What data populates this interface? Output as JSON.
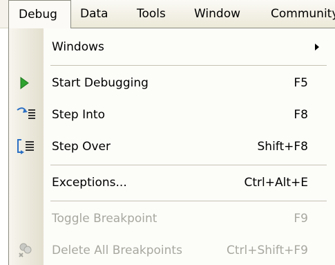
{
  "menubar": {
    "items": [
      {
        "label": "Debug"
      },
      {
        "label": "Data"
      },
      {
        "label": "Tools"
      },
      {
        "label": "Window"
      },
      {
        "label": "Community"
      }
    ]
  },
  "debug_menu": {
    "items": [
      {
        "label": "Windows",
        "shortcut": "",
        "has_submenu": true,
        "enabled": true
      },
      {
        "label": "Start Debugging",
        "shortcut": "F5",
        "icon": "play-icon",
        "enabled": true
      },
      {
        "label": "Step Into",
        "shortcut": "F8",
        "icon": "step-into-icon",
        "enabled": true
      },
      {
        "label": "Step Over",
        "shortcut": "Shift+F8",
        "icon": "step-over-icon",
        "enabled": true
      },
      {
        "label": "Exceptions...",
        "shortcut": "Ctrl+Alt+E",
        "enabled": true
      },
      {
        "label": "Toggle Breakpoint",
        "shortcut": "F9",
        "enabled": false
      },
      {
        "label": "Delete All Breakpoints",
        "shortcut": "Ctrl+Shift+F9",
        "icon": "delete-breakpoints-icon",
        "enabled": false
      }
    ]
  },
  "colors": {
    "play_green": "#2fa22f",
    "step_blue": "#2b6fc4",
    "disabled_text": "#a8a8a0",
    "menu_background": "#fcfcf9"
  }
}
